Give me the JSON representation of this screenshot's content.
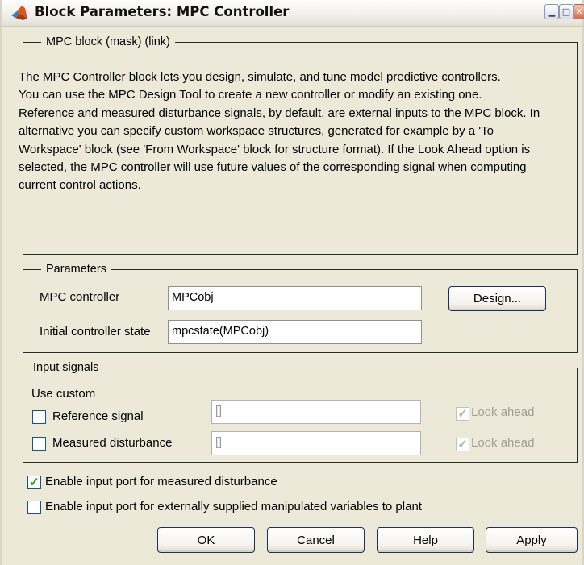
{
  "window": {
    "title": "Block Parameters: MPC Controller",
    "controls": {
      "minimize": "▁",
      "maximize": "□",
      "close": "✕"
    }
  },
  "mask_group": {
    "legend": "MPC block (mask) (link)",
    "description": [
      "The MPC Controller block lets you design, simulate, and tune model predictive controllers.",
      "You can use the MPC Design Tool to create a new controller or modify an existing one.",
      "Reference and measured disturbance signals, by default, are external inputs to the MPC block. In alternative you can specify custom workspace structures, generated for example by a 'To Workspace' block (see 'From Workspace' block for structure format). If the Look Ahead option is selected, the MPC controller will use future values of the corresponding signal when computing current control actions."
    ]
  },
  "parameters": {
    "legend": "Parameters",
    "mpc_controller_label": "MPC controller",
    "mpc_controller_value": "MPCobj",
    "design_button": "Design...",
    "initial_state_label": "Initial controller state",
    "initial_state_value": "mpcstate(MPCobj)"
  },
  "input_signals": {
    "legend": "Input signals",
    "use_custom_label": "Use custom",
    "reference": {
      "label": "Reference signal",
      "value": "[]",
      "checked": false,
      "look_ahead_label": "Look ahead",
      "look_ahead_checked": true
    },
    "measured": {
      "label": "Measured disturbance",
      "value": "[]",
      "checked": false,
      "look_ahead_label": "Look ahead",
      "look_ahead_checked": true
    }
  },
  "options": {
    "enable_md_port": {
      "label": "Enable input port for measured disturbance",
      "checked": true
    },
    "enable_mv_port": {
      "label": "Enable input port for externally supplied manipulated variables to plant",
      "checked": false
    }
  },
  "buttons": {
    "ok": "OK",
    "cancel": "Cancel",
    "help": "Help",
    "apply": "Apply"
  },
  "colors": {
    "dialog_bg": "#ece9d8",
    "check_green": "#21a121",
    "button_border": "#1f2e5f"
  }
}
